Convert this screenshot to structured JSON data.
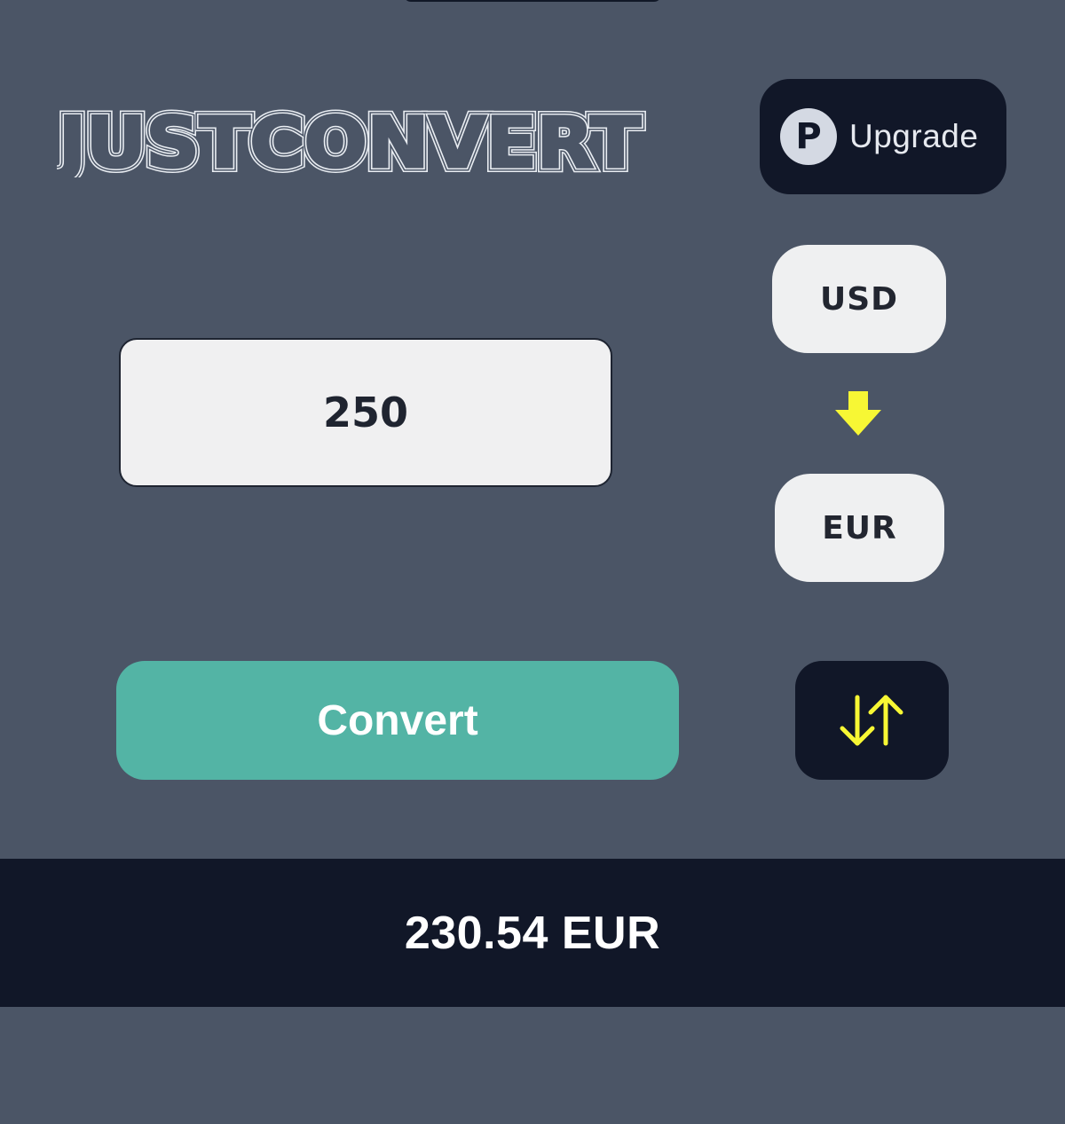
{
  "app": {
    "logo_text": "JUSTCONVERT"
  },
  "header": {
    "upgrade_badge": "P",
    "upgrade_label": "Upgrade"
  },
  "converter": {
    "amount_value": "250",
    "from_currency": "USD",
    "to_currency": "EUR",
    "convert_label": "Convert"
  },
  "result": {
    "text": "230.54 EUR"
  },
  "colors": {
    "background": "#4b5566",
    "dark_surface": "#111728",
    "accent_green": "#53b4a5",
    "arrow_yellow": "#f7f734",
    "light_button": "#eff0f1"
  },
  "icons": {
    "direction": "arrow-down-icon",
    "swap": "swap-vertical-icon"
  }
}
